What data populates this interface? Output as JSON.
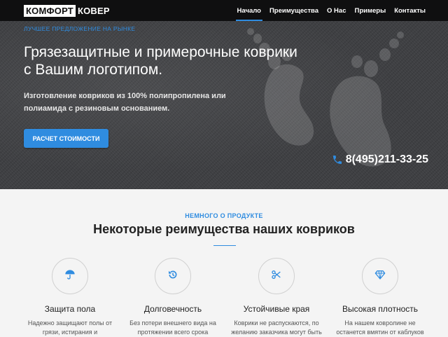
{
  "brand": {
    "logo_part1": "КОМФОРТ",
    "logo_part2": "КОВЕР"
  },
  "nav": {
    "items": [
      {
        "label": "Начало",
        "active": true
      },
      {
        "label": "Преимущества",
        "active": false
      },
      {
        "label": "О Нас",
        "active": false
      },
      {
        "label": "Примеры",
        "active": false
      },
      {
        "label": "Контакты",
        "active": false
      }
    ]
  },
  "hero": {
    "kicker": "ЛУЧШЕЕ ПРЕДЛОЖЕНИЕ НА РЫНКЕ",
    "title": "Грязезащитные и примерочные коврики с Вашим логотипом.",
    "subtitle": "Изготовление ковриков из 100% полипропилена или полиамида с резиновым основанием.",
    "cta_label": "РАСЧЕТ СТОИМОСТИ",
    "phone": "8(495)211-33-25"
  },
  "about": {
    "kicker": "НЕМНОГО О ПРОДУКТЕ",
    "title": "Некоторые реимущества наших ковриков",
    "features": [
      {
        "icon": "umbrella-icon",
        "title": "Защита пола",
        "desc": "Надежно защищают полы от грязи, истирания и"
      },
      {
        "icon": "history-icon",
        "title": "Долговечность",
        "desc": "Без потери внешнего вида на протяжении всего срока"
      },
      {
        "icon": "scissors-icon",
        "title": "Устойчивые края",
        "desc": "Коврики не распускаются, по желанию заказчика могут быть"
      },
      {
        "icon": "diamond-icon",
        "title": "Высокая плотность",
        "desc": "На нашем ковролине не останется вмятин от каблуков"
      }
    ]
  },
  "colors": {
    "accent": "#2f8ce0",
    "navbar": "#0f0f10",
    "hero_bg": "#3f4043",
    "section_bg": "#f4f4f4"
  }
}
